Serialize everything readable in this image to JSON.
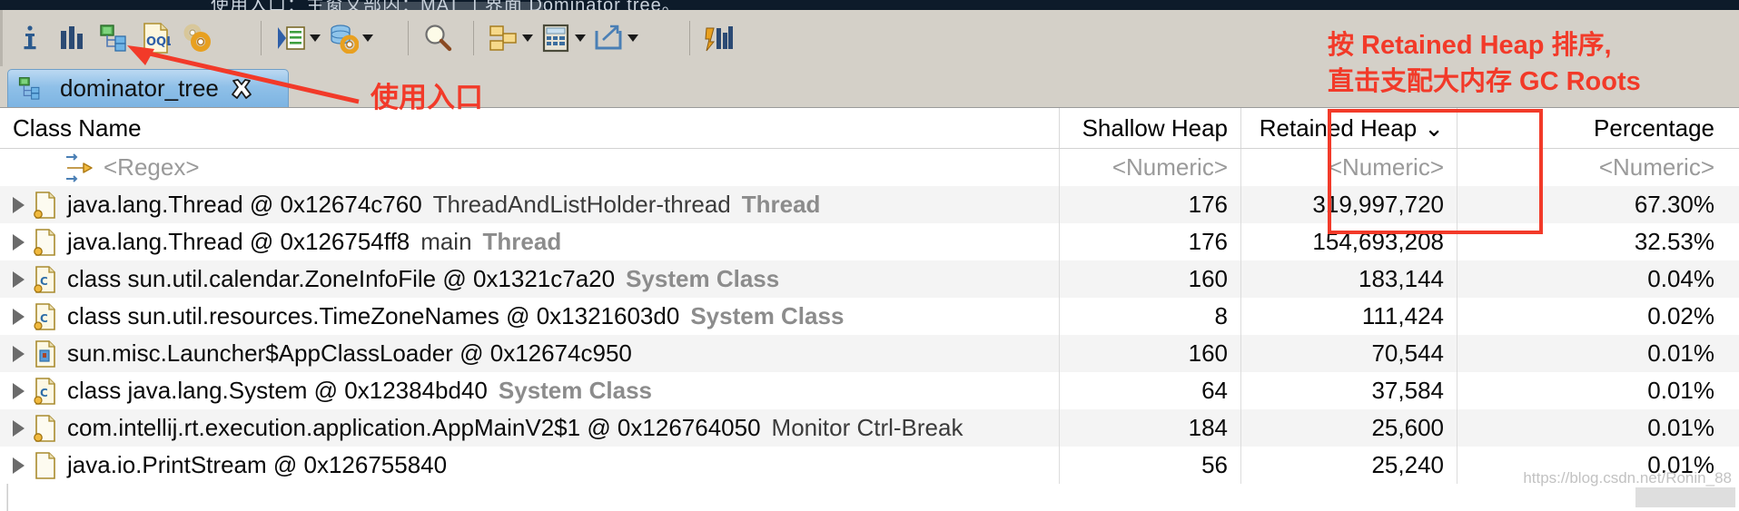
{
  "banner": {
    "text": "使用入口：主窗文部内：MAT 工界面  Dominator tree。"
  },
  "toolbar": {
    "buttons": [
      {
        "name": "info-icon",
        "label": "i",
        "has_arrow": false
      },
      {
        "name": "histogram-icon",
        "label": "Histogram",
        "has_arrow": false
      },
      {
        "name": "dominator-tree-icon",
        "label": "Dominator Tree",
        "has_arrow": false
      },
      {
        "name": "oql-icon",
        "label": "OQL",
        "has_arrow": false
      },
      {
        "name": "gears-icon",
        "label": "Settings",
        "has_arrow": false
      },
      {
        "name": "run-expert-system-icon",
        "label": "Run Expert System Test",
        "has_arrow": true
      },
      {
        "name": "query-browser-icon",
        "label": "Query Browser",
        "has_arrow": true
      },
      {
        "name": "search-icon",
        "label": "Find",
        "has_arrow": false
      },
      {
        "name": "group-by-icon",
        "label": "Group result by",
        "has_arrow": true
      },
      {
        "name": "calculator-icon",
        "label": "Calculate Precise Retained Size",
        "has_arrow": true
      },
      {
        "name": "export-icon",
        "label": "Export",
        "has_arrow": true
      },
      {
        "name": "compare-icon",
        "label": "Compare to another Heap Dump",
        "has_arrow": false
      }
    ]
  },
  "tab": {
    "label": "dominator_tree",
    "close": "✖"
  },
  "table": {
    "columns": [
      {
        "key": "class_name",
        "label": "Class Name",
        "align": "left",
        "sorted": false
      },
      {
        "key": "shallow_heap",
        "label": "Shallow Heap",
        "align": "right",
        "sorted": false
      },
      {
        "key": "retained_heap",
        "label": "Retained Heap",
        "align": "right",
        "sorted": true,
        "sort_glyph": "⌄"
      },
      {
        "key": "percentage",
        "label": "Percentage",
        "align": "right",
        "sorted": false
      }
    ],
    "filter_row": {
      "class_name": "<Regex>",
      "shallow_heap": "<Numeric>",
      "retained_heap": "<Numeric>",
      "percentage": "<Numeric>"
    },
    "rows": [
      {
        "icon": "object-instance-icon",
        "class_name": "java.lang.Thread @ 0x12674c760",
        "sub_label": "ThreadAndListHolder-thread",
        "tag": "Thread",
        "shallow_heap": "176",
        "retained_heap": "319,997,720",
        "percentage": "67.30%"
      },
      {
        "icon": "object-instance-icon",
        "class_name": "java.lang.Thread @ 0x126754ff8",
        "sub_label": "main",
        "tag": "Thread",
        "shallow_heap": "176",
        "retained_heap": "154,693,208",
        "percentage": "32.53%"
      },
      {
        "icon": "class-icon",
        "class_name": "class sun.util.calendar.ZoneInfoFile @ 0x1321c7a20",
        "sub_label": "",
        "tag": "System Class",
        "shallow_heap": "160",
        "retained_heap": "183,144",
        "percentage": "0.04%"
      },
      {
        "icon": "class-icon",
        "class_name": "class sun.util.resources.TimeZoneNames @ 0x1321603d0",
        "sub_label": "",
        "tag": "System Class",
        "shallow_heap": "8",
        "retained_heap": "111,424",
        "percentage": "0.02%"
      },
      {
        "icon": "classloader-icon",
        "class_name": "sun.misc.Launcher$AppClassLoader @ 0x12674c950",
        "sub_label": "",
        "tag": "",
        "shallow_heap": "160",
        "retained_heap": "70,544",
        "percentage": "0.01%"
      },
      {
        "icon": "class-icon",
        "class_name": "class java.lang.System @ 0x12384bd40",
        "sub_label": "",
        "tag": "System Class",
        "shallow_heap": "64",
        "retained_heap": "37,584",
        "percentage": "0.01%"
      },
      {
        "icon": "object-instance-icon",
        "class_name": "com.intellij.rt.execution.application.AppMainV2$1 @ 0x126764050",
        "sub_label": "Monitor Ctrl-Break",
        "tag": "",
        "shallow_heap": "184",
        "retained_heap": "25,600",
        "percentage": "0.01%"
      },
      {
        "icon": "plain-object-icon",
        "class_name": "java.io.PrintStream @ 0x126755840",
        "sub_label": "",
        "tag": "",
        "shallow_heap": "56",
        "retained_heap": "25,240",
        "percentage": "0.01%"
      }
    ]
  },
  "annotations": {
    "entry_point": "使用入口",
    "sort_line1": "按 Retained Heap 排序,",
    "sort_line2": "直击支配大内存 GC Roots",
    "accent_color": "#f23a29"
  },
  "watermark": {
    "text": "https://blog.csdn.net/Ronin_88"
  }
}
